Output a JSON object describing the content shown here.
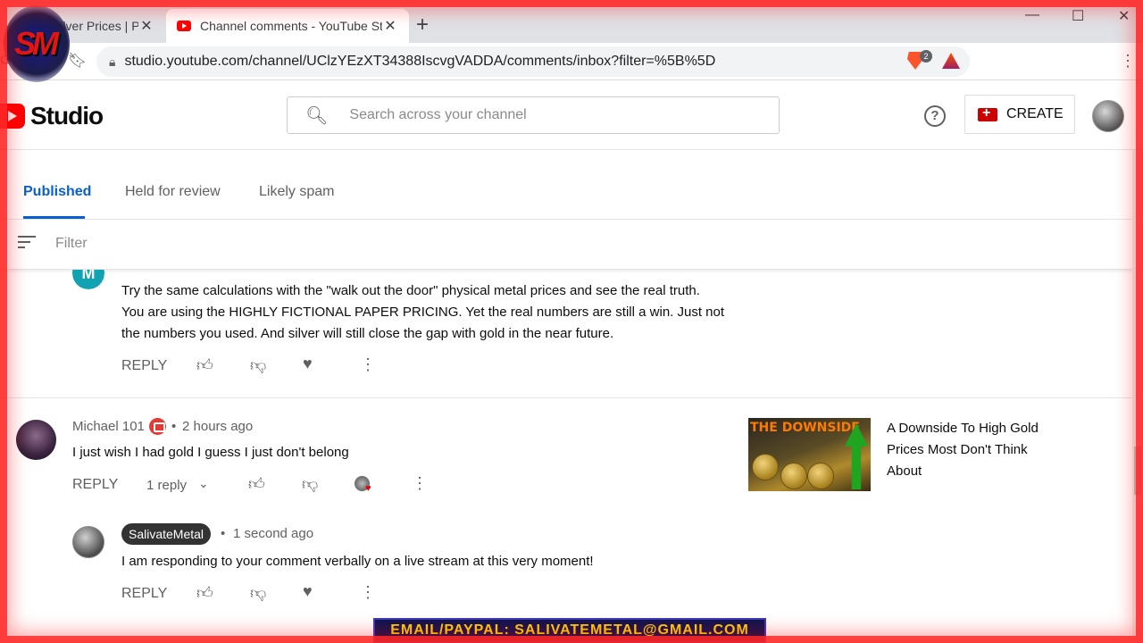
{
  "browser": {
    "tabs": [
      {
        "title": "Silver Prices | Pl..."
      },
      {
        "title": "Channel comments - YouTube Stu..."
      }
    ],
    "url": "studio.youtube.com/channel/UClzYEzXT34388IscvgVADDA/comments/inbox?filter=%5B%5D",
    "brave_badge": "2"
  },
  "header": {
    "logo_text": "Studio",
    "search_placeholder": "Search across your channel",
    "create_label": "CREATE"
  },
  "tabs": [
    "Published",
    "Held for review",
    "Likely spam"
  ],
  "filter_placeholder": "Filter",
  "comments": [
    {
      "avatar_letter": "M",
      "avatar_color": "#12a3b3",
      "lines": [
        "Try the same calculations with the \"walk out the door\" physical metal prices and see the real truth.",
        "You are using the HIGHLY FICTIONAL PAPER PRICING. Yet the real numbers are still a win. Just not",
        "the numbers you used. And silver will still close the gap with gold in the near future."
      ],
      "reply_label": "REPLY"
    },
    {
      "author": "Michael 101",
      "time": "2 hours ago",
      "text": "I just wish I had gold I guess I just don't belong",
      "reply_label": "REPLY",
      "replies_label": "1 reply",
      "video": {
        "thumb_text": "THE DOWNSIDE",
        "title": "A Downside To High Gold Prices Most Don't Think About"
      }
    },
    {
      "author": "SalivateMetal",
      "time": "1 second ago",
      "text": "I am responding to your comment verbally on a live stream at this very moment!",
      "reply_label": "REPLY"
    }
  ],
  "overlay": {
    "logo_text": "SM",
    "email_banner": "EMAIL/PAYPAL: SALIVATEMETAL@GMAIL.COM"
  },
  "colors": {
    "accent_blue": "#065fd4",
    "youtube_red": "#ff0000",
    "frame_red": "#ff2828"
  }
}
